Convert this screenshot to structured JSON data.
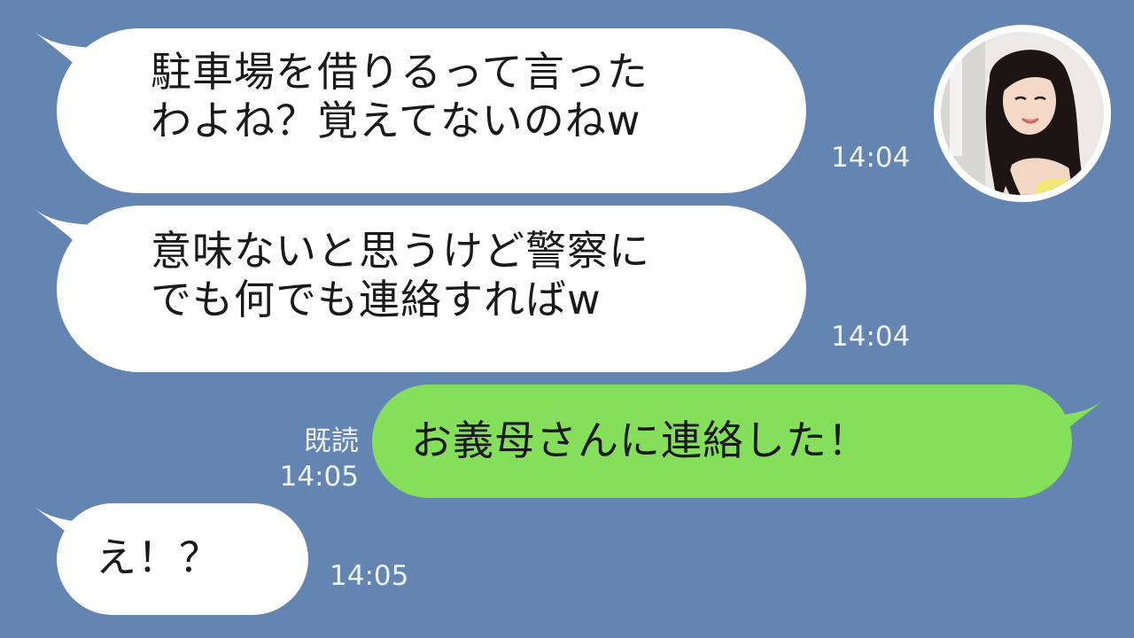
{
  "chat": {
    "messages": [
      {
        "text": "駐車場を借りるって言った\nわよね？覚えてないのねw",
        "time": "14:04"
      },
      {
        "text": "意味ないと思うけど警察に\nでも何でも連絡すればw",
        "time": "14:04"
      },
      {
        "text": "お義母さんに連絡した！",
        "time": "14:05",
        "read": "既読"
      },
      {
        "text": "え！？",
        "time": "14:05"
      }
    ]
  },
  "colors": {
    "background": "#6484b2",
    "incoming_bubble": "#ffffff",
    "outgoing_bubble": "#85df5a"
  },
  "icons": {
    "avatar": "woman-portrait-avatar"
  }
}
